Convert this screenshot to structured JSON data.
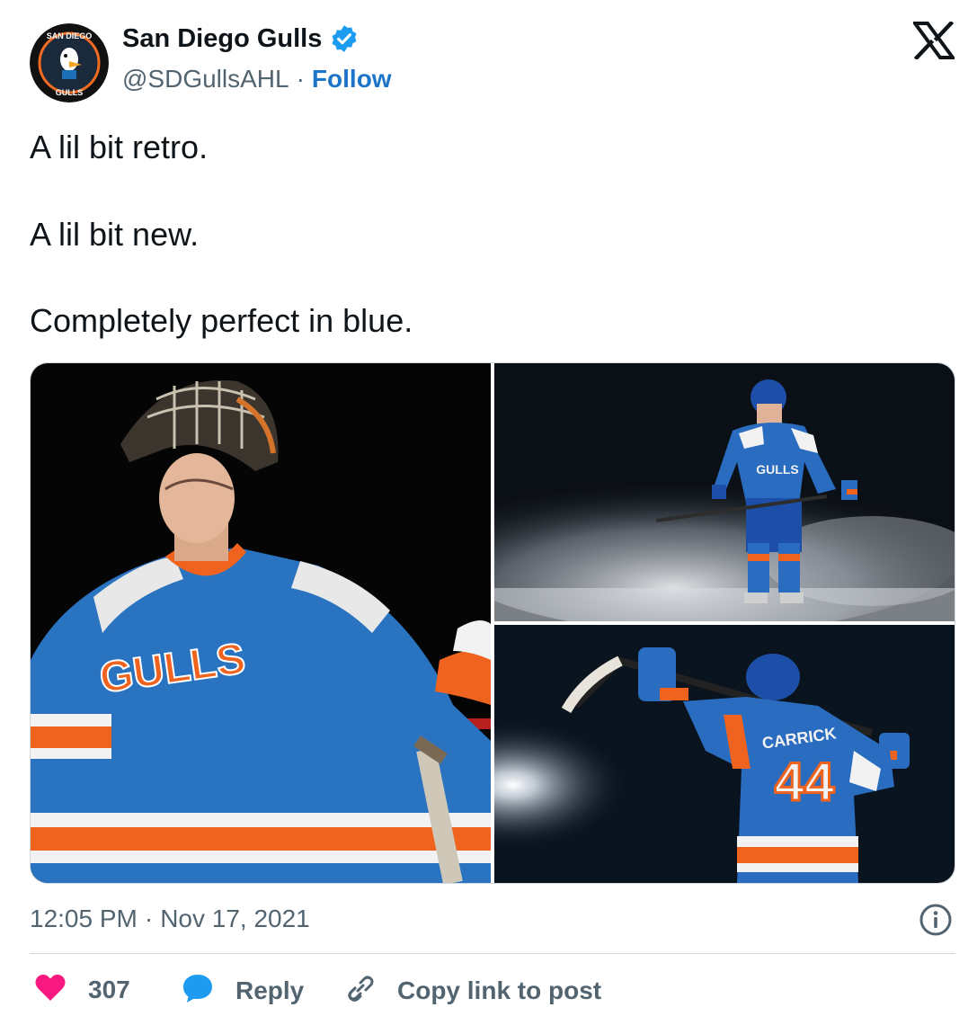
{
  "account": {
    "name": "San Diego Gulls",
    "handle": "@SDGullsAHL",
    "separator": "·",
    "follow_label": "Follow",
    "avatar_text_top": "SAN DIEGO",
    "avatar_text_bottom": "GULLS"
  },
  "tweet": {
    "lines": [
      "A lil bit retro.",
      "A lil bit new.",
      "Completely perfect in blue."
    ]
  },
  "media": {
    "photos": [
      {
        "jersey_text": "GULLS"
      },
      {
        "jersey_text": "GULLS"
      },
      {
        "jersey_text": "CARRICK",
        "number": "44"
      }
    ]
  },
  "meta": {
    "time": "12:05 PM",
    "separator": "·",
    "date": "Nov 17, 2021"
  },
  "actions": {
    "likes": "307",
    "reply_label": "Reply",
    "copy_label": "Copy link to post"
  },
  "colors": {
    "accent": "#1d75c9",
    "verified": "#1d9bf0",
    "like": "#f91880",
    "muted": "#536471",
    "text": "#0f1419"
  }
}
